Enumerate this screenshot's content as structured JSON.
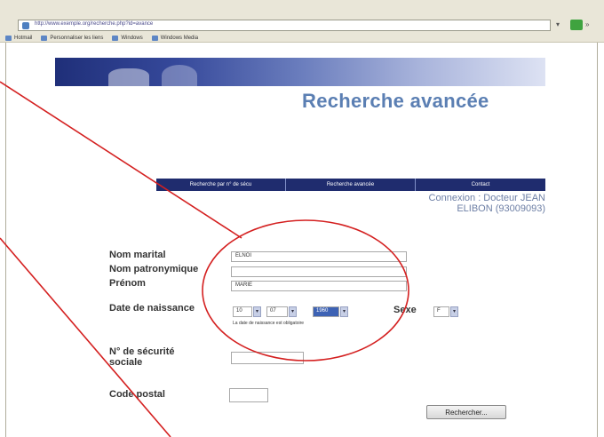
{
  "browser": {
    "address": "http://www.exemple.org/recherche.php?id=avance",
    "links": [
      "Hotmail",
      "Personnaliser les liens",
      "Windows",
      "Windows Media"
    ]
  },
  "page": {
    "title": "Recherche avancée",
    "nav": [
      "Recherche par n° de sécu",
      "Recherche avancée",
      "Contact"
    ],
    "connexion_line1": "Connexion : Docteur JEAN",
    "connexion_line2": "ELIBON (93009093)"
  },
  "form": {
    "nom_marital_label": "Nom marital",
    "nom_marital_value": "ELNOI",
    "nom_patronymique_label": "Nom patronymique",
    "nom_patronymique_value": "",
    "prenom_label": "Prénom",
    "prenom_value": "MARIE",
    "date_label": "Date de naissance",
    "day": "10",
    "month": "07",
    "year": "1960",
    "sexe_label": "Sexe",
    "sexe_value": "F",
    "date_hint": "La date de naissance est obligatoire",
    "secu_label_1": "N° de sécurité",
    "secu_label_2": "sociale",
    "secu_value": "",
    "cp_label": "Code postal",
    "cp_value": "",
    "submit_label": "Rechercher..."
  },
  "annotation_color": "#d42020"
}
